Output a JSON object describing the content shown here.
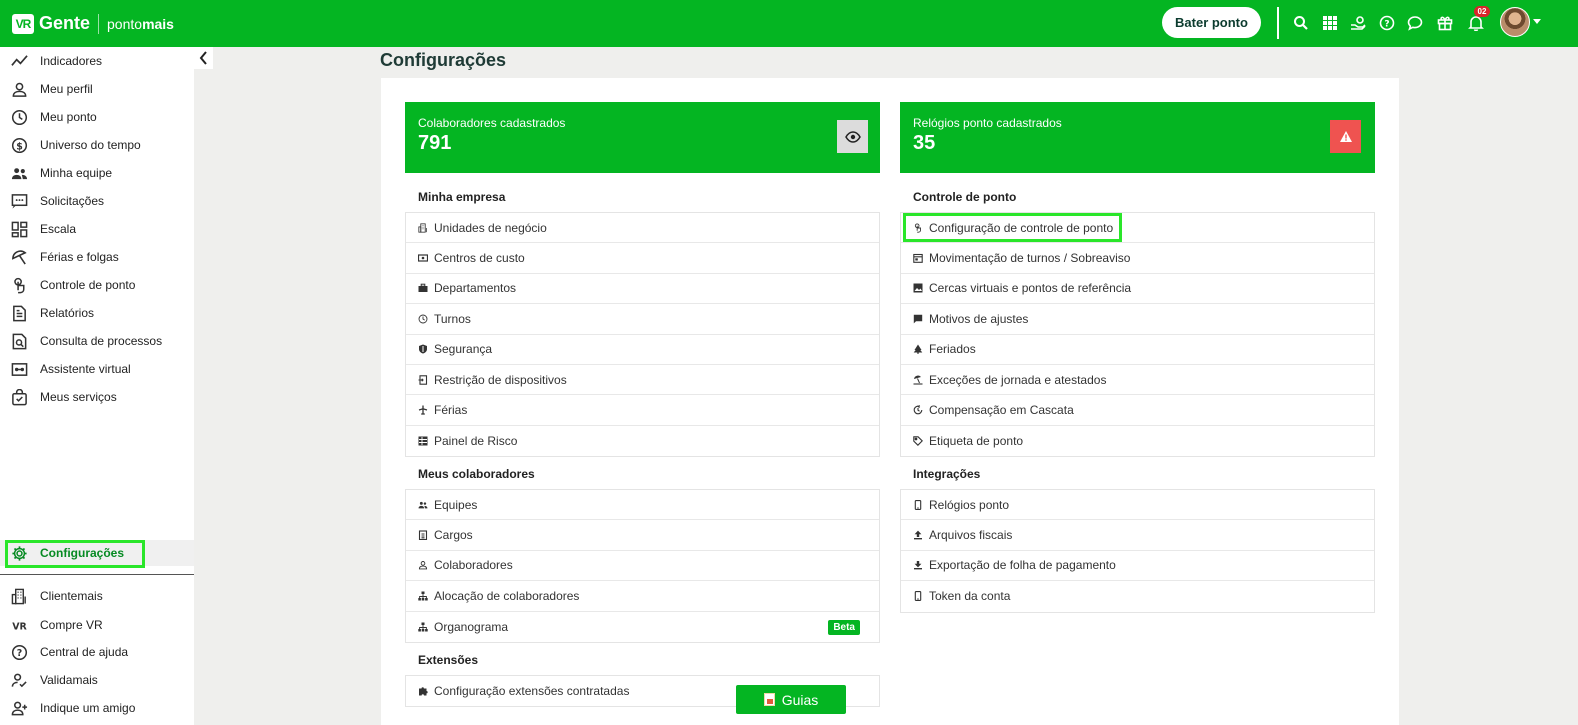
{
  "header": {
    "brand_name": "Gente",
    "brand_logo_text": "VR",
    "product_prefix": "ponto",
    "product_suffix": "mais",
    "punch_button": "Bater ponto",
    "notifications_count": "02",
    "icons": [
      "search-icon",
      "apps-grid-icon",
      "hand-coin-icon",
      "help-icon",
      "chat-icon",
      "gift-icon",
      "bell-icon"
    ]
  },
  "sidebar": {
    "items": [
      {
        "label": "Indicadores",
        "icon": "trend-line-icon"
      },
      {
        "label": "Meu perfil",
        "icon": "user-icon"
      },
      {
        "label": "Meu ponto",
        "icon": "clock-icon"
      },
      {
        "label": "Universo do tempo",
        "icon": "dollar-circle-icon"
      },
      {
        "label": "Minha equipe",
        "icon": "team-icon"
      },
      {
        "label": "Solicitações",
        "icon": "message-dots-icon"
      },
      {
        "label": "Escala",
        "icon": "dashboard-grid-icon"
      },
      {
        "label": "Férias e folgas",
        "icon": "umbrella-icon"
      },
      {
        "label": "Controle de ponto",
        "icon": "touch-icon"
      },
      {
        "label": "Relatórios",
        "icon": "document-icon"
      },
      {
        "label": "Consulta de processos",
        "icon": "search-document-icon"
      },
      {
        "label": "Assistente virtual",
        "icon": "assistant-icon"
      },
      {
        "label": "Meus serviços",
        "icon": "bag-icon"
      }
    ],
    "active": {
      "label": "Configurações",
      "icon": "gear-icon"
    },
    "bottom_items": [
      {
        "label": "Clientemais",
        "icon": "building-icon"
      },
      {
        "label": "Compre VR",
        "icon": "vr-logo-icon"
      },
      {
        "label": "Central de ajuda",
        "icon": "help-circle-icon"
      },
      {
        "label": "Validamais",
        "icon": "user-check-icon"
      },
      {
        "label": "Indique um amigo",
        "icon": "user-plus-icon"
      }
    ]
  },
  "page": {
    "title": "Configurações",
    "stats": [
      {
        "label": "Colaboradores cadastrados",
        "value": "791",
        "action_icon": "eye-icon"
      },
      {
        "label": "Relógios ponto cadastrados",
        "value": "35",
        "action_icon": "warning-icon"
      }
    ],
    "sections_left": [
      {
        "title": "Minha empresa",
        "items": [
          {
            "label": "Unidades de negócio",
            "icon": "building-icon"
          },
          {
            "label": "Centros de custo",
            "icon": "money-icon"
          },
          {
            "label": "Departamentos",
            "icon": "briefcase-icon"
          },
          {
            "label": "Turnos",
            "icon": "clock-icon"
          },
          {
            "label": "Segurança",
            "icon": "shield-icon"
          },
          {
            "label": "Restrição de dispositivos",
            "icon": "login-icon"
          },
          {
            "label": "Férias",
            "icon": "plane-icon"
          },
          {
            "label": "Painel de Risco",
            "icon": "table-icon"
          }
        ]
      },
      {
        "title": "Meus colaboradores",
        "items": [
          {
            "label": "Equipes",
            "icon": "team-icon"
          },
          {
            "label": "Cargos",
            "icon": "id-badge-icon"
          },
          {
            "label": "Colaboradores",
            "icon": "user-icon"
          },
          {
            "label": "Alocação de colaboradores",
            "icon": "org-chart-icon"
          },
          {
            "label": "Organograma",
            "icon": "org-chart-icon",
            "badge": "Beta"
          }
        ]
      },
      {
        "title": "Extensões",
        "items": [
          {
            "label": "Configuração extensões contratadas",
            "icon": "puzzle-icon"
          }
        ]
      }
    ],
    "sections_right": [
      {
        "title": "Controle de ponto",
        "items": [
          {
            "label": "Configuração de controle de ponto",
            "icon": "touch-icon"
          },
          {
            "label": "Movimentação de turnos / Sobreaviso",
            "icon": "calendar-icon"
          },
          {
            "label": "Cercas virtuais e pontos de referência",
            "icon": "map-image-icon"
          },
          {
            "label": "Motivos de ajustes",
            "icon": "comment-icon"
          },
          {
            "label": "Feriados",
            "icon": "tree-icon"
          },
          {
            "label": "Exceções de jornada e atestados",
            "icon": "beach-icon"
          },
          {
            "label": "Compensação em Cascata",
            "icon": "clock-cycle-icon"
          },
          {
            "label": "Etiqueta de ponto",
            "icon": "tag-icon"
          }
        ]
      },
      {
        "title": "Integrações",
        "items": [
          {
            "label": "Relógios ponto",
            "icon": "phone-icon"
          },
          {
            "label": "Arquivos fiscais",
            "icon": "upload-icon"
          },
          {
            "label": "Exportação de folha de pagamento",
            "icon": "download-icon"
          },
          {
            "label": "Token da conta",
            "icon": "phone-icon"
          }
        ]
      }
    ],
    "guides_button": "Guias"
  },
  "colors": {
    "brand_green": "#04b522",
    "highlight": "#2ae62a",
    "warning": "#ef5350"
  }
}
